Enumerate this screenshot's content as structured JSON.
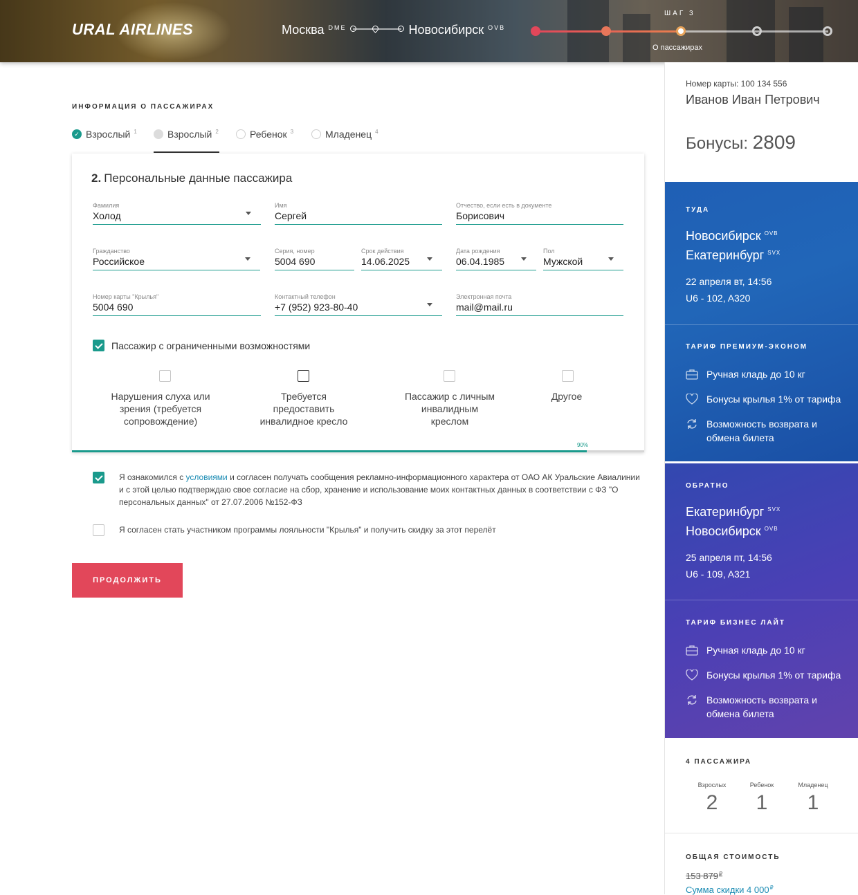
{
  "header": {
    "logo": "URAL AIRLINES",
    "from_city": "Москва",
    "from_code": "DME",
    "to_city": "Новосибирск",
    "to_code": "OVB",
    "step_label": "ШАГ 3",
    "step_name": "О пассажирах",
    "colors": {
      "step_red": "#e2475a",
      "step_orange": "#e8a35a",
      "step_inactive": "#cfcfcf"
    }
  },
  "main": {
    "section_title": "ИНФОРМАЦИЯ О ПАССАЖИРАХ",
    "passenger_tabs": [
      {
        "label": "Взрослый",
        "num": "1",
        "state": "done"
      },
      {
        "label": "Взрослый",
        "num": "2",
        "state": "active"
      },
      {
        "label": "Ребенок",
        "num": "3",
        "state": "empty"
      },
      {
        "label": "Младенец",
        "num": "4",
        "state": "empty"
      }
    ],
    "form": {
      "number": "2.",
      "title": "Персональные данные пассажира",
      "fields": {
        "surname": {
          "label": "Фамилия",
          "value": "Холод"
        },
        "name": {
          "label": "Имя",
          "value": "Сергей"
        },
        "patronymic": {
          "label": "Отчество, если есть в документе",
          "value": "Борисович"
        },
        "citizenship": {
          "label": "Гражданство",
          "value": "Российское"
        },
        "doc_number": {
          "label": "Серия, номер",
          "value": "5004 690"
        },
        "expiry": {
          "label": "Срок действия",
          "value": "14.06.2025"
        },
        "birth": {
          "label": "Дата рождения",
          "value": "06.04.1985"
        },
        "gender": {
          "label": "Пол",
          "value": "Мужской"
        },
        "card_number": {
          "label": "Номер карты \"Крылья\"",
          "value": "5004 690"
        },
        "phone": {
          "label": "Контактный телефон",
          "value": "+7 (952) 923-80-40"
        },
        "email": {
          "label": "Электронная почта",
          "value": "mail@mail.ru"
        }
      },
      "limited_mobility": {
        "label": "Пассажир с ограниченными возможностями",
        "checked": true
      },
      "options": [
        {
          "label": "Нарушения слуха или зрения (требуется сопровождение)"
        },
        {
          "label": "Требуется предоставить инвалидное кресло"
        },
        {
          "label": "Пассажир с личным инвалидным креслом"
        },
        {
          "label": "Другое"
        }
      ],
      "progress_percent": 90,
      "progress_label": "90%"
    },
    "consent1": {
      "before": "Я ознакомился с ",
      "link": "условиями",
      "after": " и согласен получать сообщения рекламно-информационного характера от ОАО АК Уральские Авиалинии и с этой целью подтверждаю свое согласие на сбор, хранение и использование моих контактных данных в соответствии с ФЗ \"О персональных данных\" от 27.07.2006 №152-ФЗ",
      "checked": true
    },
    "consent2": {
      "text": "Я согласен стать участником программы лояльности \"Крылья\" и получить скидку за этот перелёт",
      "checked": false
    },
    "continue_label": "ПРОДОЛЖИТЬ"
  },
  "sidebar": {
    "card_number": "Номер карты: 100 134 556",
    "name": "Иванов Иван Петрович",
    "bonus_label": "Бонусы:",
    "bonus_value": "2809",
    "outbound": {
      "head": "ТУДА",
      "from": "Новосибирск",
      "from_code": "OVB",
      "to": "Екатеринбург",
      "to_code": "SVX",
      "date": "22 апреля вт, 14:56",
      "flight": "U6 - 102, A320"
    },
    "tariff1": {
      "head": "ТАРИФ ПРЕМИУМ-ЭКОНОМ",
      "features": [
        "Ручная кладь до 10 кг",
        "Бонусы крылья 1% от тарифа",
        "Возможность возврата и обмена билета"
      ]
    },
    "return": {
      "head": "ОБРАТНО",
      "from": "Екатеринбург",
      "from_code": "SVX",
      "to": "Новосибирск",
      "to_code": "OVB",
      "date": "25 апреля пт, 14:56",
      "flight": "U6 - 109, A321"
    },
    "tariff2": {
      "head": "ТАРИФ БИЗНЕС ЛАЙТ",
      "features": [
        "Ручная кладь до 10 кг",
        "Бонусы крылья 1% от тарифа",
        "Возможность возврата и обмена билета"
      ]
    },
    "passengers": {
      "title": "4 ПАССАЖИРА",
      "adults_label": "Взрослых",
      "adults": "2",
      "children_label": "Ребенок",
      "children": "1",
      "infants_label": "Младенец",
      "infants": "1"
    },
    "total": {
      "title": "ОБЩАЯ СТОИМОСТЬ",
      "old_price": "153 879",
      "discount_label": "Сумма скидки 4 000",
      "currency": "₽"
    }
  }
}
